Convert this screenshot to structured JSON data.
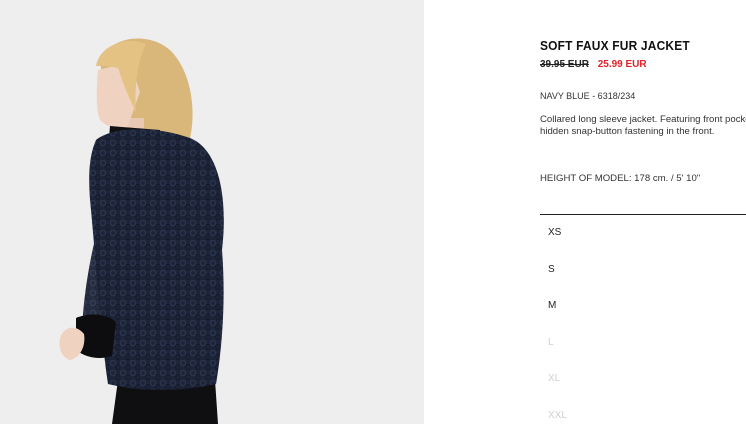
{
  "product": {
    "title": "SOFT FAUX FUR JACKET",
    "price_old": "39.95 EUR",
    "price_new": "25.99 EUR",
    "color_ref": "NAVY BLUE - 6318/234",
    "description": "Collared long sleeve jacket. Featuring front pockets and hidden snap-button fastening in the front.",
    "model_height": "HEIGHT OF MODEL: 178 cm. / 5' 10\""
  },
  "sizes": [
    {
      "label": "XS",
      "available": true
    },
    {
      "label": "S",
      "available": true
    },
    {
      "label": "M",
      "available": true
    },
    {
      "label": "L",
      "available": false
    },
    {
      "label": "XL",
      "available": false
    },
    {
      "label": "XXL",
      "available": false
    }
  ],
  "colors": {
    "sale_price": "#e0222a",
    "unavailable_size": "#cfcfcf",
    "jacket": "#1d2438",
    "photo_background": "#eeeeee"
  }
}
